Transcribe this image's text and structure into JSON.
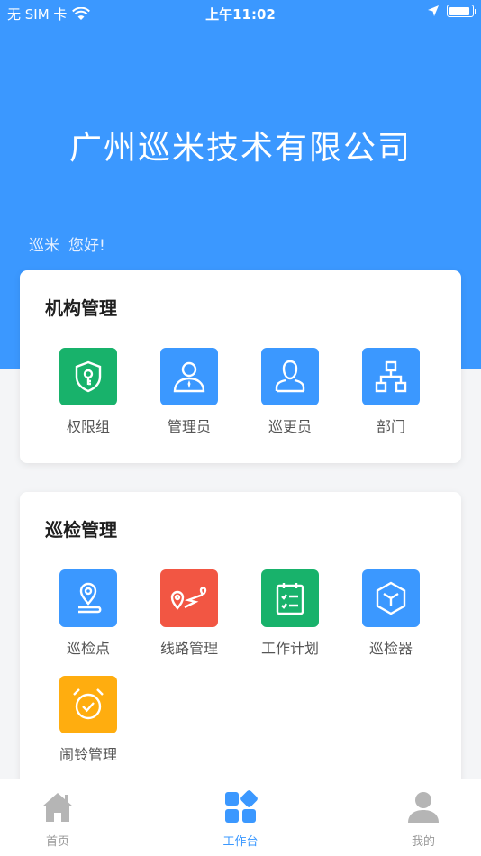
{
  "status_bar": {
    "carrier": "无 SIM 卡",
    "time": "上午11:02"
  },
  "header": {
    "company_name": "广州巡米技术有限公司",
    "user_name": "巡米",
    "greeting": "您好!"
  },
  "org_section": {
    "title": "机构管理",
    "items": [
      {
        "label": "权限组",
        "icon": "shield-key-icon",
        "color": "#18b26b"
      },
      {
        "label": "管理员",
        "icon": "manager-icon",
        "color": "#3b98ff"
      },
      {
        "label": "巡更员",
        "icon": "person-icon",
        "color": "#3b98ff"
      },
      {
        "label": "部门",
        "icon": "org-chart-icon",
        "color": "#3b98ff"
      }
    ]
  },
  "patrol_section": {
    "title": "巡检管理",
    "items": [
      {
        "label": "巡检点",
        "icon": "location-pin-icon",
        "color": "#3b98ff"
      },
      {
        "label": "线路管理",
        "icon": "route-icon",
        "color": "#f25643"
      },
      {
        "label": "工作计划",
        "icon": "checklist-icon",
        "color": "#18b26b"
      },
      {
        "label": "巡检器",
        "icon": "device-cube-icon",
        "color": "#3b98ff"
      },
      {
        "label": "闹铃管理",
        "icon": "alarm-clock-icon",
        "color": "#ffad0f"
      }
    ]
  },
  "tab_bar": {
    "tabs": [
      {
        "label": "首页",
        "icon": "home-icon"
      },
      {
        "label": "工作台",
        "icon": "workbench-icon"
      },
      {
        "label": "我的",
        "icon": "profile-icon"
      }
    ],
    "active_index": 1,
    "active_color": "#3b98ff",
    "inactive_color": "#b5b5b5"
  },
  "theme": {
    "primary": "#3b98ff"
  }
}
